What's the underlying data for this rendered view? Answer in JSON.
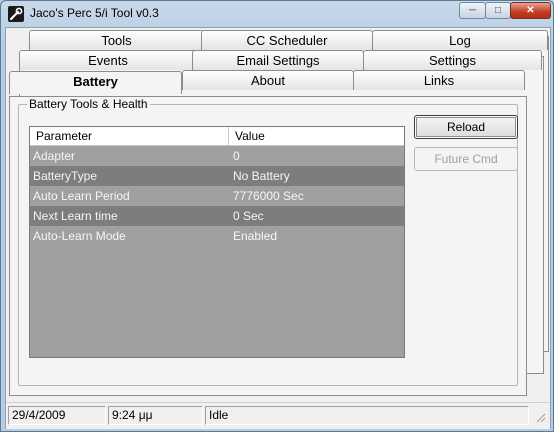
{
  "window": {
    "title": "Jaco's Perc 5/i Tool v0.3"
  },
  "tabs": {
    "row1": [
      "Tools",
      "CC Scheduler",
      "Log"
    ],
    "row2": [
      "Events",
      "Email Settings",
      "Settings"
    ],
    "row3": [
      "Battery",
      "About",
      "Links"
    ],
    "active": "Battery"
  },
  "battery": {
    "group_label": "Battery Tools & Health",
    "columns": [
      "Parameter",
      "Value"
    ],
    "rows": [
      {
        "parameter": "Adapter",
        "value": "0"
      },
      {
        "parameter": "BatteryType",
        "value": "No Battery"
      },
      {
        "parameter": "Auto Learn Period",
        "value": "7776000 Sec"
      },
      {
        "parameter": "Next Learn time",
        "value": "0 Sec"
      },
      {
        "parameter": "Auto-Learn Mode",
        "value": "Enabled"
      }
    ],
    "reload_label": "Reload",
    "future_label": "Future Cmd"
  },
  "status": {
    "date": "29/4/2009",
    "time": "9:24 μμ",
    "state": "Idle"
  }
}
